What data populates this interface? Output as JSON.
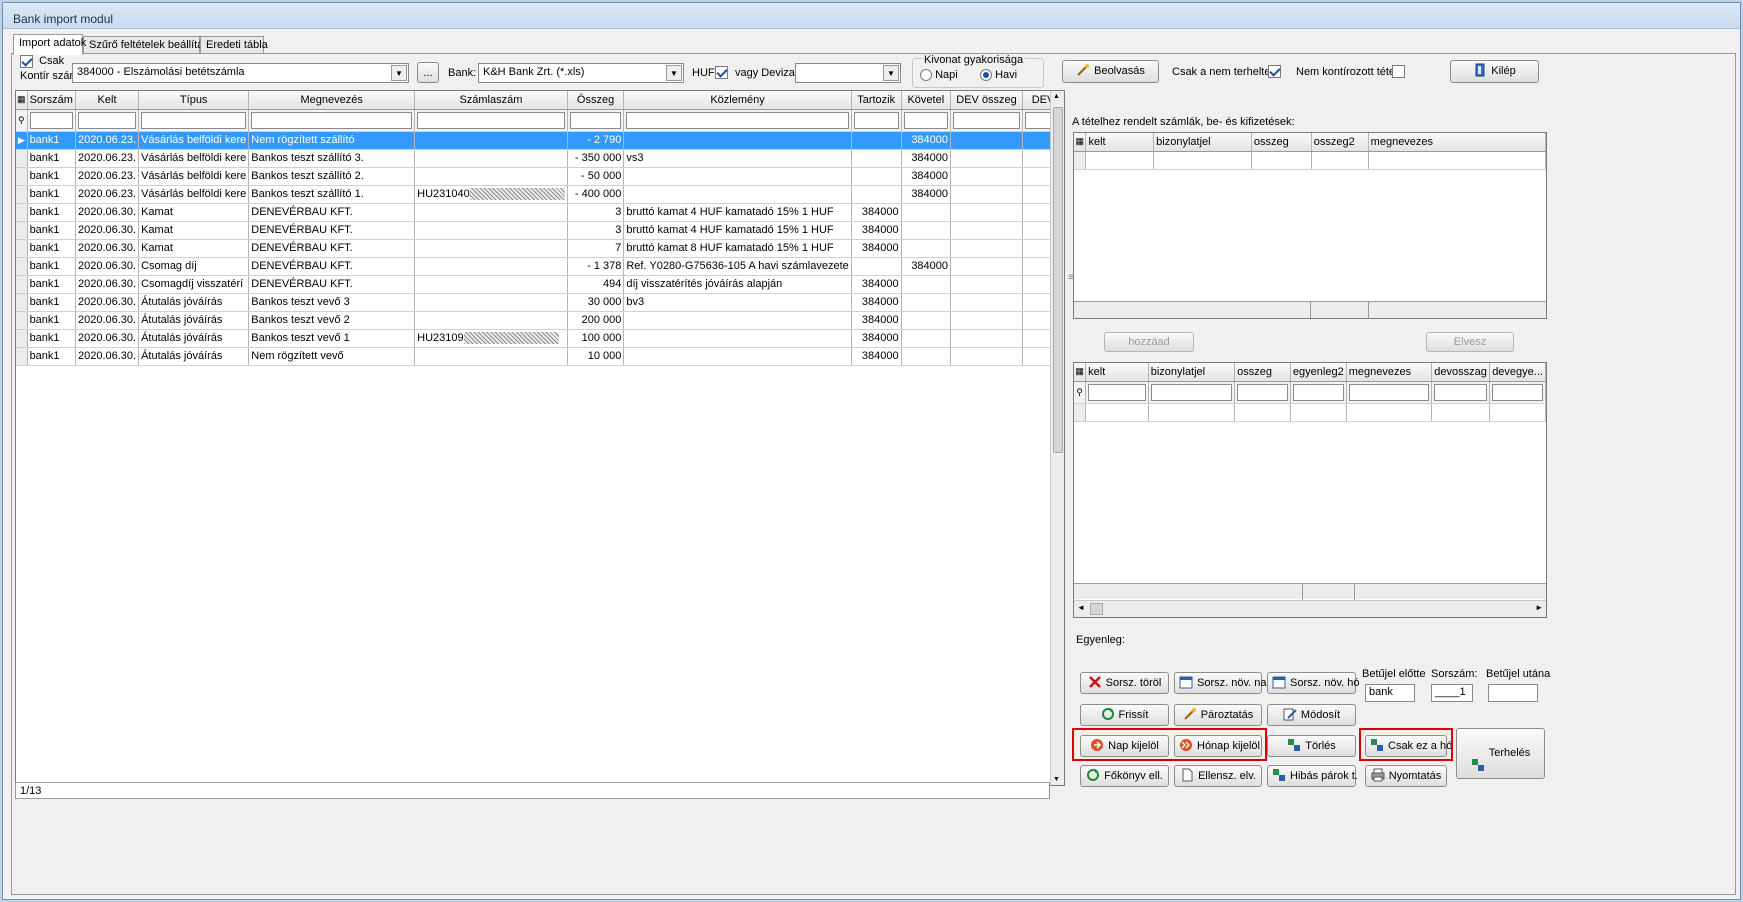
{
  "window": {
    "title": "Bank import modul"
  },
  "tabs": [
    {
      "label": "Import adatok"
    },
    {
      "label": "Szűrő feltételek beállítása"
    },
    {
      "label": "Eredeti tábla"
    }
  ],
  "toolbar": {
    "csak_label": "Csak",
    "kontir_label": "Kontír szám:",
    "kontir_value": "384000 - Elszámolási betétszámla",
    "ellipsis_label": "...",
    "bank_label": "Bank:",
    "bank_value": "K&H Bank Zrt. (*.xls)",
    "huf_label": "HUF",
    "deviza_label": "vagy Deviza:",
    "deviza_value": "",
    "kivonat_label": "Kivonat gyakorisága",
    "napi_label": "Napi",
    "havi_label": "Havi",
    "beolvasas_label": "Beolvasás",
    "csak_nem_terheltek_label": "Csak a nem terheltek",
    "nem_kontirozott_label": "Nem kontírozott tétel.",
    "kilep_label": "Kilép"
  },
  "main_grid": {
    "columns": [
      "Sorszám",
      "Kelt",
      "Típus",
      "Megnevezés",
      "Számlaszám",
      "Összeg",
      "Közlemény",
      "Tartozik",
      "Követel",
      "DEV összeg",
      "DEV"
    ],
    "rows": [
      [
        "bank1",
        "2020.06.23.",
        "Vásárlás belföldi kere",
        "Nem rögzített szállító",
        "",
        "- 2 790",
        "",
        "",
        "384000",
        "",
        ""
      ],
      [
        "bank1",
        "2020.06.23.",
        "Vásárlás belföldi kere",
        "Bankos teszt szállító 3.",
        "",
        "- 350 000",
        "vs3",
        "",
        "384000",
        "",
        ""
      ],
      [
        "bank1",
        "2020.06.23.",
        "Vásárlás belföldi kere",
        "Bankos teszt szállító 2.",
        "",
        "- 50 000",
        "",
        "",
        "384000",
        "",
        ""
      ],
      [
        "bank1",
        "2020.06.23.",
        "Vásárlás belföldi kere",
        "Bankos teszt szállító 1.",
        "HU231040",
        "- 400 000",
        "",
        "",
        "384000",
        "",
        ""
      ],
      [
        "bank1",
        "2020.06.30.",
        "Kamat",
        "DENEVÉRBAU KFT.",
        "",
        "3",
        "bruttó kamat 4 HUF kamatadó 15% 1 HUF",
        "384000",
        "",
        "",
        ""
      ],
      [
        "bank1",
        "2020.06.30.",
        "Kamat",
        "DENEVÉRBAU KFT.",
        "",
        "3",
        "bruttó kamat 4 HUF kamatadó 15% 1 HUF",
        "384000",
        "",
        "",
        ""
      ],
      [
        "bank1",
        "2020.06.30.",
        "Kamat",
        "DENEVÉRBAU KFT.",
        "",
        "7",
        "bruttó kamat 8 HUF kamatadó 15% 1 HUF",
        "384000",
        "",
        "",
        ""
      ],
      [
        "bank1",
        "2020.06.30.",
        "Csomag díj",
        "DENEVÉRBAU KFT.",
        "",
        "- 1 378",
        "Ref. Y0280-G75636-105 A havi számlavezete",
        "",
        "384000",
        "",
        ""
      ],
      [
        "bank1",
        "2020.06.30.",
        "Csomagdíj visszatérí",
        "DENEVÉRBAU KFT.",
        "",
        "494",
        "díj visszatérítés jóváírás alapján",
        "384000",
        "",
        "",
        ""
      ],
      [
        "bank1",
        "2020.06.30.",
        "Átutalás jóváírás",
        "Bankos teszt vevő 3",
        "",
        "30 000",
        "bv3",
        "384000",
        "",
        "",
        ""
      ],
      [
        "bank1",
        "2020.06.30.",
        "Átutalás jóváírás",
        "Bankos teszt vevő 2",
        "",
        "200 000",
        "",
        "384000",
        "",
        "",
        ""
      ],
      [
        "bank1",
        "2020.06.30.",
        "Átutalás jóváírás",
        "Bankos teszt vevő 1",
        "HU23109",
        "100 000",
        "",
        "384000",
        "",
        "",
        ""
      ],
      [
        "bank1",
        "2020.06.30.",
        "Átutalás jóváírás",
        "Nem rögzített vevő",
        "",
        "10 000",
        "",
        "384000",
        "",
        "",
        ""
      ]
    ],
    "status": "1/13"
  },
  "right_panel": {
    "assigned_label": "A tételhez rendelt számlák, be- és kifizetések:",
    "top_grid_columns": [
      "kelt",
      "bizonylatjel",
      "osszeg",
      "osszeg2",
      "megnevezes"
    ],
    "hozzaad_label": "hozzáad",
    "elvesz_label": "Elvesz",
    "bottom_grid_columns": [
      "kelt",
      "bizonylatjel",
      "osszeg",
      "egyenleg2",
      "megnevezes",
      "devosszag",
      "devegye..."
    ],
    "egyenleg_label": "Egyenleg:"
  },
  "actions": {
    "sorsz_torol": "Sorsz. töröl",
    "sorsz_nov_nap": "Sorsz. növ. nap",
    "sorsz_nov_ho": "Sorsz. növ. hó",
    "betujel_elotte_label": "Betűjel előtte",
    "betujel_elotte_value": "bank",
    "sorszam_label": "Sorszám:",
    "sorszam_value": "____1",
    "betujel_utana_label": "Betűjel utána",
    "betujel_utana_value": "",
    "frissit": "Frissít",
    "paroztatas": "Pároztatás",
    "modosit": "Módosít",
    "nap_kijelol": "Nap kijelöl",
    "honap_kijelol": "Hónap kijelöl",
    "torles": "Törlés",
    "csak_ez_a_ho": "Csak ez a hó",
    "terheles": "Terhelés",
    "fokonyv_ell": "Főkönyv ell.",
    "ellensz_elv": "Ellensz. elv.",
    "hibas_parok": "Hibás párok t.",
    "nyomtatas": "Nyomtatás"
  },
  "colors": {
    "selection": "#3399ff",
    "highlight_border": "#e00000"
  }
}
